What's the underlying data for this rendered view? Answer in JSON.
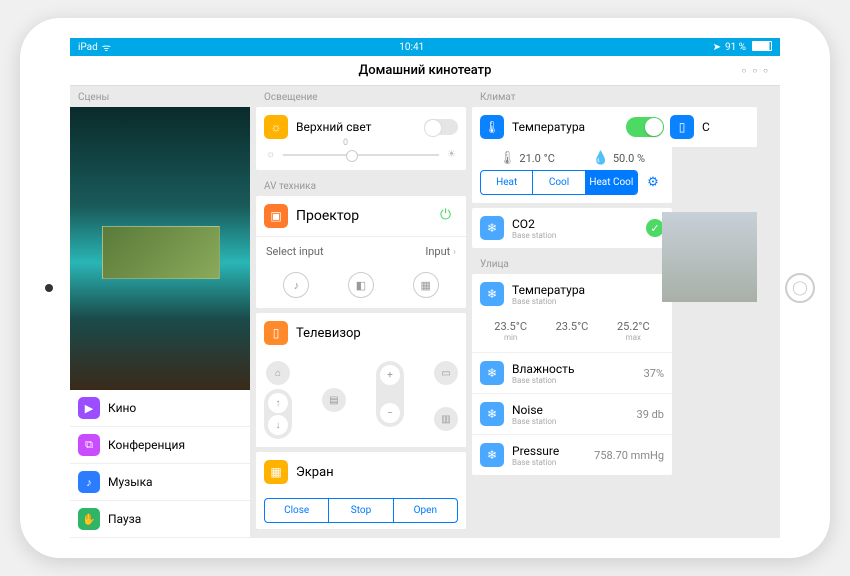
{
  "statusbar": {
    "device": "iPad",
    "time": "10:41",
    "battery": "91 %"
  },
  "titlebar": {
    "title": "Домашний кинотеатр"
  },
  "scenes": {
    "label": "Сцены",
    "items": [
      {
        "label": "Кино",
        "color": "#9b4dff",
        "glyph": "▶"
      },
      {
        "label": "Конференция",
        "color": "#c94dff",
        "glyph": "⧉"
      },
      {
        "label": "Музыка",
        "color": "#2b7cff",
        "glyph": "♪"
      },
      {
        "label": "Пауза",
        "color": "#2fb566",
        "glyph": "✋"
      }
    ]
  },
  "lighting": {
    "label": "Освещение",
    "list": [
      {
        "icon": "☼",
        "color": "#ffb300",
        "label": "Верхний свет"
      }
    ],
    "slider_value": "0"
  },
  "av": {
    "label": "AV техника",
    "projector": {
      "icon": "▣",
      "color": "#ff7a2b",
      "label": "Проектор",
      "select_label": "Select input",
      "select_value": "Input"
    },
    "tv": {
      "icon": "📺",
      "color": "#ff8a2b",
      "label": "Телевизор"
    },
    "screen": {
      "icon": "▦",
      "color": "#ffb300",
      "label": "Экран",
      "buttons": [
        "Close",
        "Stop",
        "Open"
      ]
    }
  },
  "climate": {
    "label": "Климат",
    "temp": {
      "icon": "🌡",
      "color": "#0b82ff",
      "label": "Температура",
      "on": true,
      "value": "21.0 °C",
      "humidity": "50.0 %",
      "modes": [
        "Heat",
        "Cool",
        "Heat Cool"
      ],
      "active_mode": 2
    },
    "co2": {
      "color": "#4aa8ff",
      "label": "CO2",
      "sub": "Base station"
    }
  },
  "outdoor": {
    "label": "Улица",
    "temp": {
      "label": "Температура",
      "sub": "Base station",
      "min": "23.5°C",
      "min_l": "min",
      "cur": "23.5°C",
      "max": "25.2°C",
      "max_l": "max"
    },
    "humidity": {
      "label": "Влажность",
      "sub": "Base station",
      "value": "37%"
    },
    "noise": {
      "label": "Noise",
      "sub": "Base station",
      "value": "39 db"
    },
    "pressure": {
      "label": "Pressure",
      "sub": "Base station",
      "value": "758.70 mmHg"
    }
  },
  "col4": {
    "peek_label": "С"
  }
}
